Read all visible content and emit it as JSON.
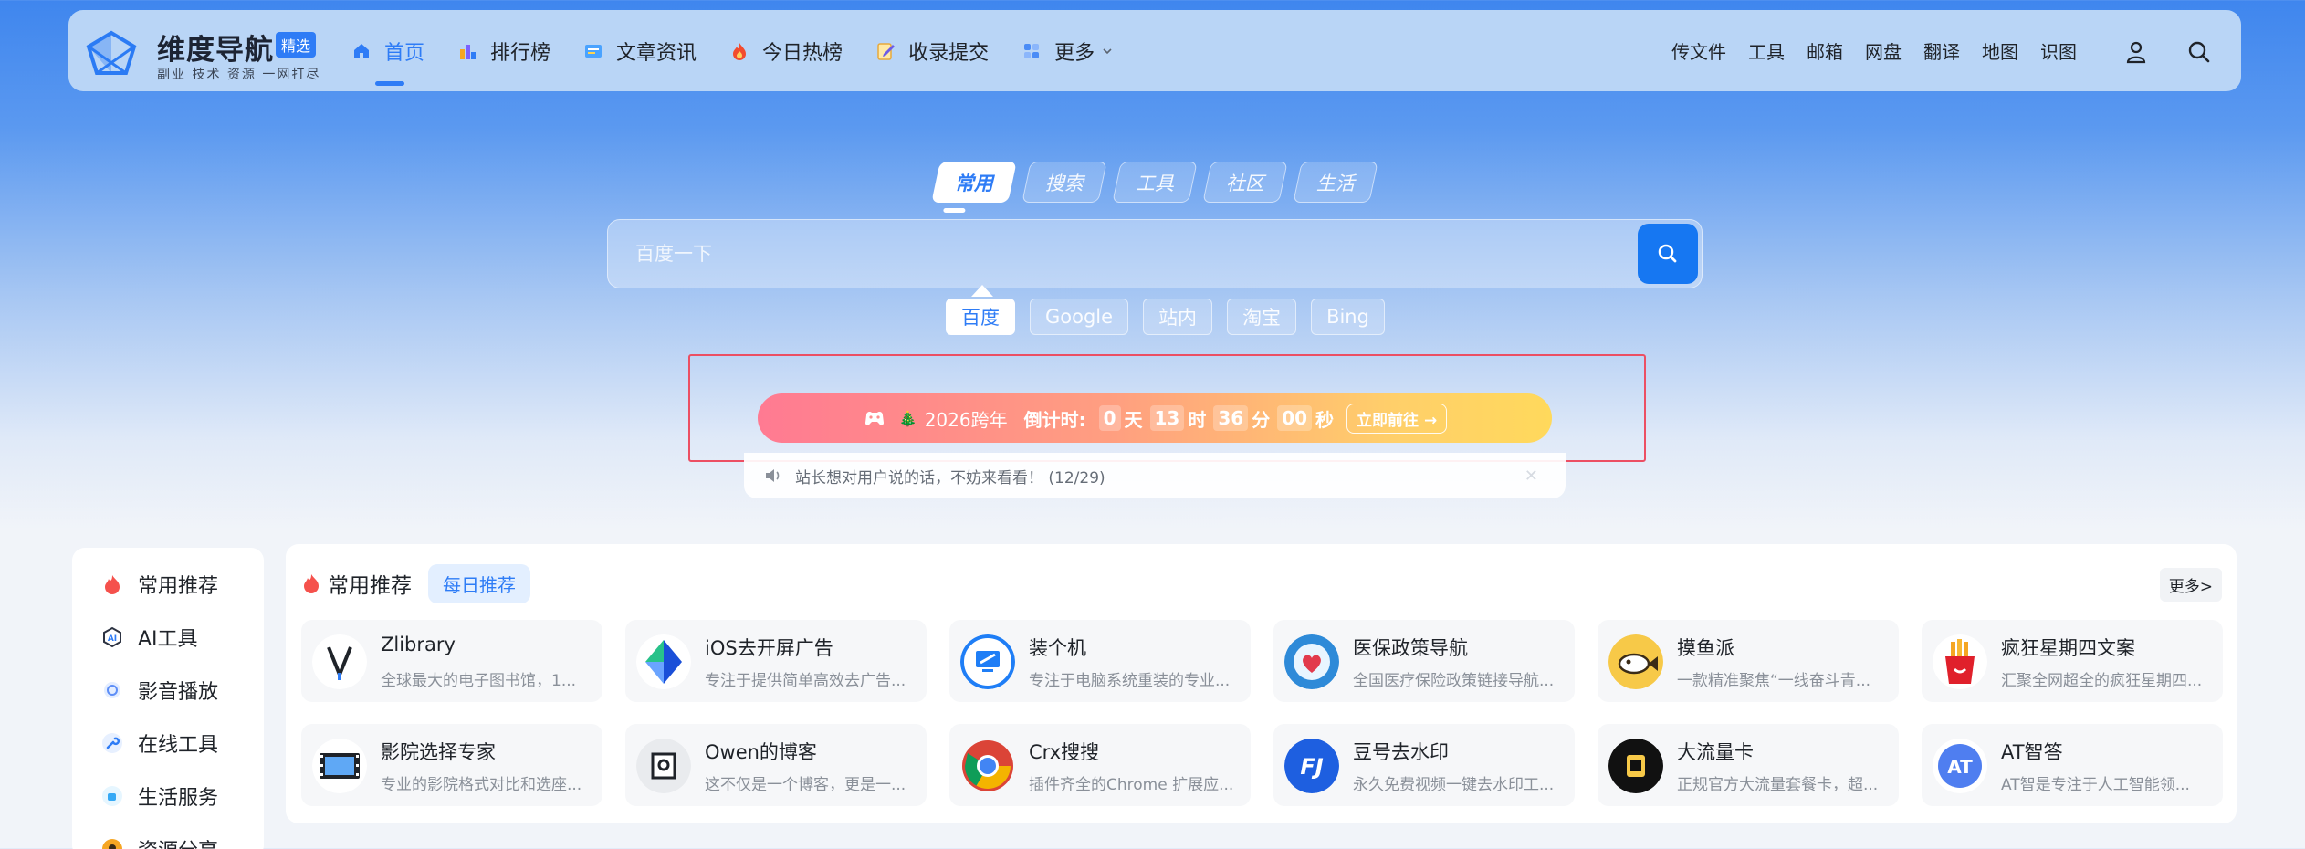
{
  "header": {
    "logo": {
      "title": "维度导航",
      "badge": "精选",
      "subtitle": "副业 技术 资源 一网打尽"
    },
    "nav": [
      {
        "label": "首页",
        "icon": "home-icon",
        "active": true
      },
      {
        "label": "排行榜",
        "icon": "ranking-icon"
      },
      {
        "label": "文章资讯",
        "icon": "article-icon"
      },
      {
        "label": "今日热榜",
        "icon": "fire-icon"
      },
      {
        "label": "收录提交",
        "icon": "submit-icon"
      },
      {
        "label": "更多",
        "icon": "grid-icon"
      }
    ],
    "links": [
      "传文件",
      "工具",
      "邮箱",
      "网盘",
      "翻译",
      "地图",
      "识图"
    ]
  },
  "search": {
    "tabs": [
      "常用",
      "搜索",
      "工具",
      "社区",
      "生活"
    ],
    "active_tab": "常用",
    "placeholder": "百度一下",
    "engines": [
      "百度",
      "Google",
      "站内",
      "淘宝",
      "Bing"
    ],
    "active_engine": "百度"
  },
  "countdown": {
    "year_text": "2026跨年",
    "label": "倒计时:",
    "days": "0",
    "day_unit": "天",
    "hours": "13",
    "hour_unit": "时",
    "minutes": "36",
    "minute_unit": "分",
    "seconds": "00",
    "second_unit": "秒",
    "button": "立即前往 →"
  },
  "notice": {
    "text": "站长想对用户说的话，不妨来看看！ (12/29)"
  },
  "sidebar": {
    "items": [
      {
        "label": "常用推荐",
        "icon": "fire-icon"
      },
      {
        "label": "AI工具",
        "icon": "ai-icon"
      },
      {
        "label": "影音播放",
        "icon": "media-icon"
      },
      {
        "label": "在线工具",
        "icon": "wrench-icon"
      },
      {
        "label": "生活服务",
        "icon": "cup-icon"
      },
      {
        "label": "资源分享",
        "icon": "share-icon"
      }
    ]
  },
  "panel": {
    "title": "常用推荐",
    "tab": "每日推荐",
    "more": "更多>",
    "cards": [
      {
        "title": "Zlibrary",
        "desc": "全球最大的电子图书馆，1...",
        "icon": "zlibrary-icon"
      },
      {
        "title": "iOS去开屏广告",
        "desc": "专注于提供简单高效去广告...",
        "icon": "ios-adblock-icon"
      },
      {
        "title": "装个机",
        "desc": "专注于电脑系统重装的专业...",
        "icon": "pc-install-icon"
      },
      {
        "title": "医保政策导航",
        "desc": "全国医疗保险政策链接导航...",
        "icon": "medical-icon"
      },
      {
        "title": "摸鱼派",
        "desc": "一款精准聚焦“一线奋斗青...",
        "icon": "fish-icon"
      },
      {
        "title": "疯狂星期四文案",
        "desc": "汇聚全网超全的疯狂星期四...",
        "icon": "fries-icon"
      },
      {
        "title": "影院选择专家",
        "desc": "专业的影院格式对比和选座...",
        "icon": "film-icon"
      },
      {
        "title": "Owen的博客",
        "desc": "这不仅是一个博客，更是一...",
        "icon": "blog-icon"
      },
      {
        "title": "Crx搜搜",
        "desc": "插件齐全的Chrome 扩展应...",
        "icon": "chrome-icon"
      },
      {
        "title": "豆号去水印",
        "desc": "永久免费视频一键去水印工...",
        "icon": "watermark-icon"
      },
      {
        "title": "大流量卡",
        "desc": "正规官方大流量套餐卡，超...",
        "icon": "sim-card-icon"
      },
      {
        "title": "AT智答",
        "desc": "AT智是专注于人工智能领...",
        "icon": "ai-answer-icon"
      }
    ]
  },
  "colors": {
    "accent": "#2e7cf6",
    "highlight_frame": "#ec4f63"
  }
}
